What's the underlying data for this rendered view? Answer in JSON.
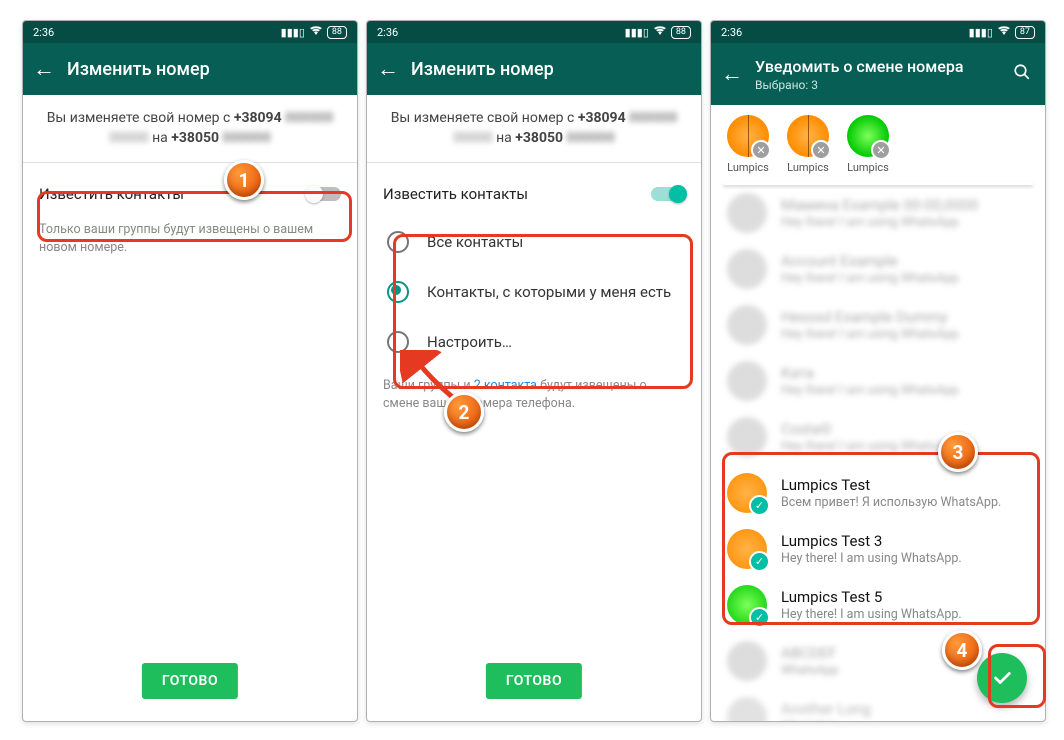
{
  "status": {
    "time": "2:36",
    "battery1": "88",
    "battery2": "88",
    "battery3": "87"
  },
  "screen1": {
    "title": "Изменить номер",
    "info_prefix": "Вы изменяете свой номер с ",
    "old_prefix": "+38094",
    "info_mid": " на ",
    "new_prefix": "+38050",
    "notify_label": "Известить контакты",
    "hint": "Только ваши группы будут извещены о вашем новом номере.",
    "done": "ГОТОВО"
  },
  "screen2": {
    "title": "Изменить номер",
    "info_prefix": "Вы изменяете свой номер с ",
    "old_prefix": "+38094",
    "info_mid": " на ",
    "new_prefix": "+38050",
    "notify_label": "Известить контакты",
    "options": {
      "all": "Все контакты",
      "chats": "Контакты, с которыми у меня есть",
      "custom": "Настроить…"
    },
    "hint_prefix": "Ваши группы и ",
    "hint_link": "2 контакта",
    "hint_suffix": " будут извещены о смене вашего номера телефона.",
    "done": "ГОТОВО"
  },
  "screen3": {
    "title": "Уведомить о смене номера",
    "subtitle": "Выбрано: 3",
    "chips": [
      {
        "name": "Lumpics",
        "color": "orange"
      },
      {
        "name": "Lumpics",
        "color": "orange"
      },
      {
        "name": "Lumpics",
        "color": "green"
      }
    ],
    "blurred_status": "Hey there! I am using WhatsApp.",
    "selected": [
      {
        "name": "Lumpics Test",
        "status": "Всем привет! Я использую WhatsApp.",
        "color": "orange"
      },
      {
        "name": "Lumpics Test 3",
        "status": "Hey there! I am using WhatsApp.",
        "color": "orange"
      },
      {
        "name": "Lumpics Test 5",
        "status": "Hey there! I am using WhatsApp.",
        "color": "green"
      }
    ]
  },
  "badges": {
    "b1": "1",
    "b2": "2",
    "b3": "3",
    "b4": "4"
  }
}
